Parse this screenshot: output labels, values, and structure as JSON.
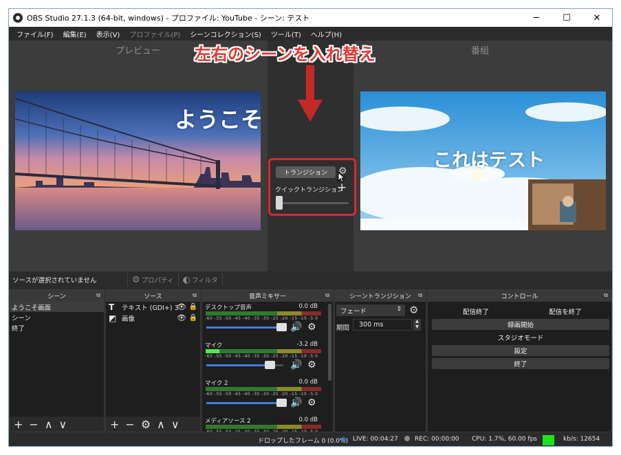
{
  "window": {
    "title": "OBS Studio 27.1.3 (64-bit, windows) - プロファイル: YouTube - シーン: テスト",
    "minimize_glyph": "─",
    "maximize_glyph": "☐",
    "close_glyph": "✕"
  },
  "menu": {
    "items": [
      {
        "label": "ファイル(F)",
        "disabled": false
      },
      {
        "label": "編集(E)",
        "disabled": false
      },
      {
        "label": "表示(V)",
        "disabled": false
      },
      {
        "label": "プロファイル(P)",
        "disabled": true
      },
      {
        "label": "シーンコレクション(S)",
        "disabled": false
      },
      {
        "label": "ツール(T)",
        "disabled": false
      },
      {
        "label": "ヘルプ(H)",
        "disabled": false
      }
    ]
  },
  "preview": {
    "preview_label": "プレビュー",
    "program_label": "番組",
    "left_scene_text": "ようこそ",
    "right_scene_text": "これはテスト"
  },
  "annotation": {
    "title": "左右のシーンを入れ替え",
    "color": "#e53935"
  },
  "transition_panel": {
    "button_label": "トランジション",
    "quick_label": "クイックトランジション",
    "plus": "+",
    "slider_value": 0
  },
  "source_bar": {
    "no_selection": "ソースが選択されていません",
    "properties_label": "プロパティ",
    "filters_label": "フィルタ"
  },
  "scenes": {
    "header": "シーン",
    "items": [
      {
        "label": "ようこそ画面",
        "selected": true
      },
      {
        "label": "シーン",
        "selected": false
      },
      {
        "label": "終了",
        "selected": false
      }
    ]
  },
  "sources": {
    "header": "ソース",
    "items": [
      {
        "label": "テキスト (GDI+) 3",
        "type_icon": "T"
      },
      {
        "label": "画像",
        "type_icon": "◩"
      }
    ]
  },
  "mixer": {
    "header": "音声ミキサー",
    "ticks": "-60 -55 -50 -45 -40 -35 -30 -25 -20 -15 -10 -5 0",
    "channels": [
      {
        "name": "デスクトップ音声",
        "db": "0.0 dB",
        "level": 0.0,
        "volume": 1.0
      },
      {
        "name": "マイク",
        "db": "-3.2 dB",
        "level": 0.12,
        "volume": 0.85
      },
      {
        "name": "マイク 2",
        "db": "0.0 dB",
        "level": 0.0,
        "volume": 1.0
      },
      {
        "name": "メディアソース 2",
        "db": "0.0 dB",
        "level": 0.0,
        "volume": 1.0
      }
    ]
  },
  "scene_transitions": {
    "header": "シーントランジション",
    "selected": "フェード",
    "duration_label": "期間",
    "duration_value": "300 ms"
  },
  "controls": {
    "header": "コントロール",
    "stop_stream_1": "配信終了",
    "stop_stream_2": "配信を終了",
    "start_recording": "録画開始",
    "studio_mode": "スタジオモード",
    "settings": "設定",
    "exit": "終了"
  },
  "status": {
    "dropped_frames": "ドロップしたフレーム 0 (0.0%)",
    "live": "LIVE: 00:04:27",
    "rec": "REC: 00:00:00",
    "cpu": "CPU: 1.7%, 60.00 fps",
    "kbps": "kb/s: 12654",
    "indicator_color": "#19e619"
  }
}
